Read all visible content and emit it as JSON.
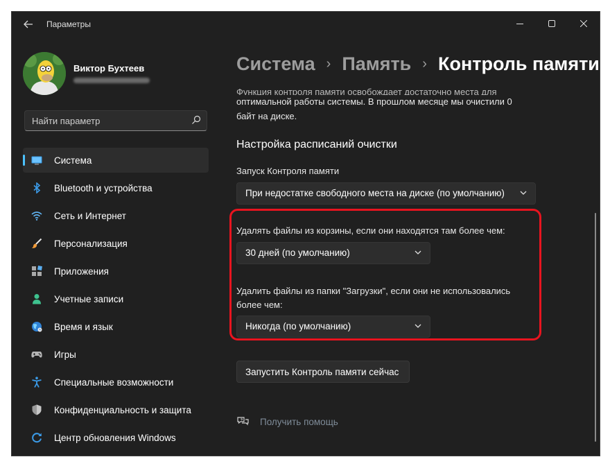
{
  "window": {
    "app_title": "Параметры",
    "controls": {
      "minimize": "minimize-icon",
      "maximize": "maximize-icon",
      "close": "close-icon"
    }
  },
  "user": {
    "name": "Виктор Бухтеев"
  },
  "search": {
    "placeholder": "Найти параметр"
  },
  "nav": {
    "items": [
      {
        "label": "Система",
        "icon": "monitor-icon",
        "active": true
      },
      {
        "label": "Bluetooth и устройства",
        "icon": "bluetooth-icon"
      },
      {
        "label": "Сеть и Интернет",
        "icon": "wifi-icon"
      },
      {
        "label": "Персонализация",
        "icon": "brush-icon"
      },
      {
        "label": "Приложения",
        "icon": "apps-icon"
      },
      {
        "label": "Учетные записи",
        "icon": "person-icon"
      },
      {
        "label": "Время и язык",
        "icon": "globe-icon"
      },
      {
        "label": "Игры",
        "icon": "gamepad-icon"
      },
      {
        "label": "Специальные возможности",
        "icon": "accessibility-icon"
      },
      {
        "label": "Конфиденциальность и защита",
        "icon": "shield-icon"
      },
      {
        "label": "Центр обновления Windows",
        "icon": "update-icon"
      }
    ]
  },
  "breadcrumb": {
    "items": [
      "Система",
      "Память",
      "Контроль памяти"
    ],
    "separator": "›"
  },
  "content": {
    "intro_line1": "Функция контроля памяти освобождает достаточно места для",
    "intro_line2": "оптимальной работы системы. В прошлом месяце мы очистили 0",
    "intro_line3": "байт на диске.",
    "section_title": "Настройка расписаний очистки",
    "run_label": "Запуск Контроля памяти",
    "run_value": "При недостатке свободного места на диске (по умолчанию)",
    "recycle_label": "Удалять файлы из корзины, если они находятся там более чем:",
    "recycle_value": "30 дней (по умолчанию)",
    "downloads_label_line1": "Удалить файлы из папки \"Загрузки\", если они не использовались",
    "downloads_label_line2": "более чем:",
    "downloads_value": "Никогда (по умолчанию)",
    "run_now_button": "Запустить Контроль памяти сейчас",
    "help_link": "Получить помощь"
  },
  "colors": {
    "accent": "#4cc2ff",
    "highlight": "#e8141f",
    "background": "#202020"
  }
}
